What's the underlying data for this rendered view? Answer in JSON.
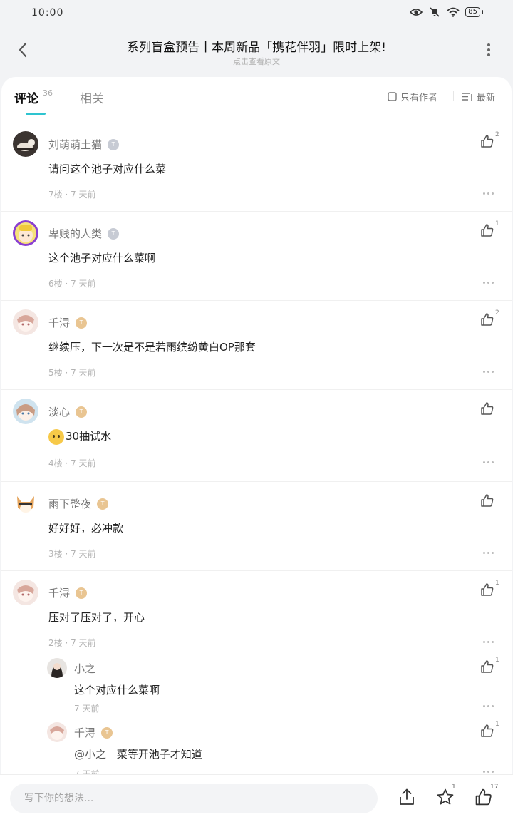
{
  "status": {
    "time": "10:00",
    "battery": "85"
  },
  "header": {
    "title": "系列盲盒预告丨本周新品「携花伴羽」限时上架!",
    "subtitle": "点击查看原文"
  },
  "tabs": {
    "comments_label": "评论",
    "comments_count": "36",
    "related_label": "相关"
  },
  "filters": {
    "author_only": "只看作者",
    "sort": "最新"
  },
  "comments": [
    {
      "name": "刘萌萌土猫",
      "text": "请问这个池子对应什么菜",
      "meta": "7楼 · 7 天前",
      "likes": "2"
    },
    {
      "name": "卑贱的人类",
      "text": "这个池子对应什么菜啊",
      "meta": "6楼 · 7 天前",
      "likes": "1"
    },
    {
      "name": "千浔",
      "text": "继续压，下一次是不是若雨缤纷黄白OP那套",
      "meta": "5楼 · 7 天前",
      "likes": "2"
    },
    {
      "name": "淡心",
      "text": "30抽试水",
      "meta": "4楼 · 7 天前",
      "likes": ""
    },
    {
      "name": "雨下整夜",
      "text": "好好好，必冲款",
      "meta": "3楼 · 7 天前",
      "likes": ""
    },
    {
      "name": "千浔",
      "text": "压对了压对了，开心",
      "meta": "2楼 · 7 天前",
      "likes": "1"
    }
  ],
  "replies": [
    {
      "name": "小之",
      "text": "这个对应什么菜啊",
      "meta": "7 天前",
      "likes": "1"
    },
    {
      "name": "千浔",
      "mention": "@小之",
      "text": "菜等开池子才知道",
      "meta": "7 天前",
      "likes": "1"
    }
  ],
  "bottom": {
    "placeholder": "写下你的想法...",
    "favorite_count": "1",
    "like_count": "17"
  }
}
